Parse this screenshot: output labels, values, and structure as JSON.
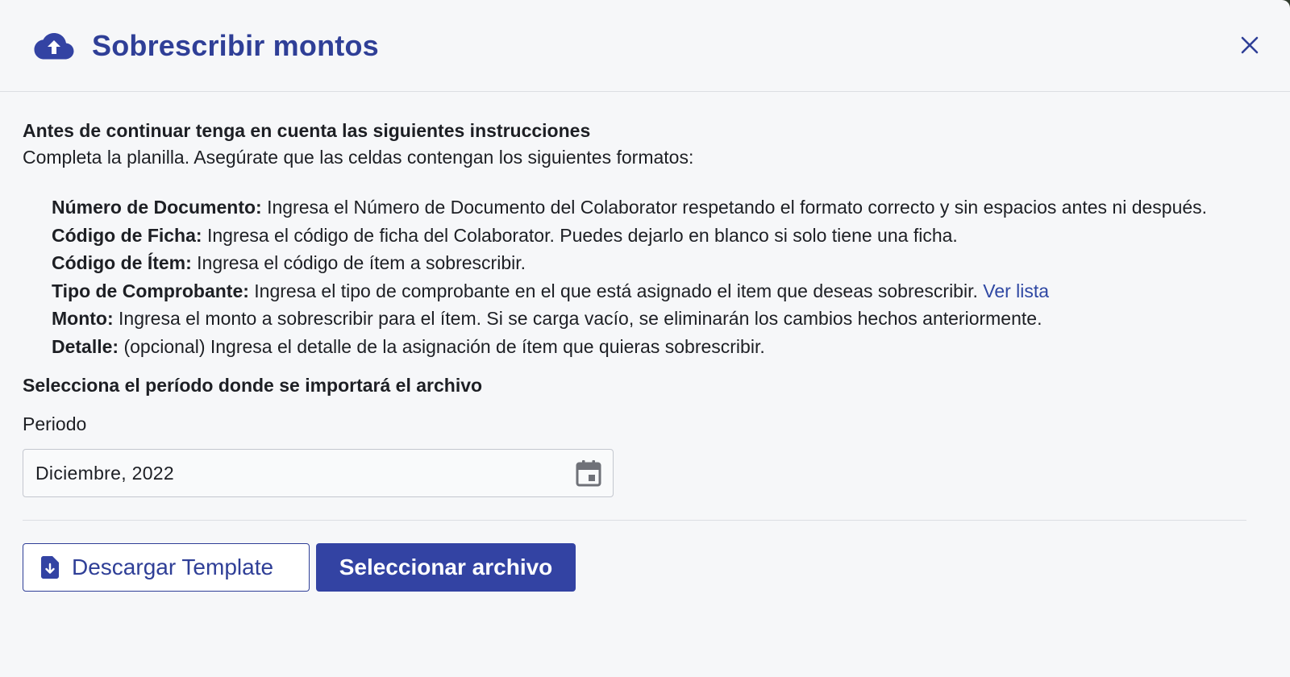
{
  "header": {
    "icon": "cloud-upload-icon",
    "title": "Sobrescribir montos",
    "close_icon": "close-icon"
  },
  "instructions": {
    "heading": "Antes de continuar tenga en cuenta las siguientes instrucciones",
    "intro": "Completa la planilla. Asegúrate que las celdas contengan los siguientes formatos:",
    "fields": [
      {
        "label": "Número de Documento:",
        "text": " Ingresa el Número de Documento del Colaborator respetando el formato correcto y sin espacios antes ni después."
      },
      {
        "label": "Código de Ficha:",
        "text": " Ingresa el código de ficha del Colaborator. Puedes dejarlo en blanco si solo tiene una ficha."
      },
      {
        "label": "Código de Ítem:",
        "text": " Ingresa el código de ítem a sobrescribir."
      },
      {
        "label": "Tipo de Comprobante:",
        "text": " Ingresa el tipo de comprobante en el que está asignado el item que deseas sobrescribir. ",
        "link": "Ver lista"
      },
      {
        "label": "Monto:",
        "text": " Ingresa el monto a sobrescribir para el ítem. Si se carga vacío, se eliminarán los cambios hechos anteriormente."
      },
      {
        "label": "Detalle:",
        "text": " (opcional) Ingresa el detalle de la asignación de ítem que quieras sobrescribir."
      }
    ]
  },
  "period": {
    "heading": "Selecciona el período donde se importará el archivo",
    "label": "Periodo",
    "value": "Diciembre, 2022",
    "icon": "calendar-icon"
  },
  "actions": {
    "download_label": "Descargar Template",
    "download_icon": "file-download-icon",
    "select_label": "Seleccionar archivo"
  },
  "colors": {
    "primary": "#3343a3",
    "title": "#2f3f97",
    "link": "#2f48a3",
    "background": "#f6f7f9"
  }
}
